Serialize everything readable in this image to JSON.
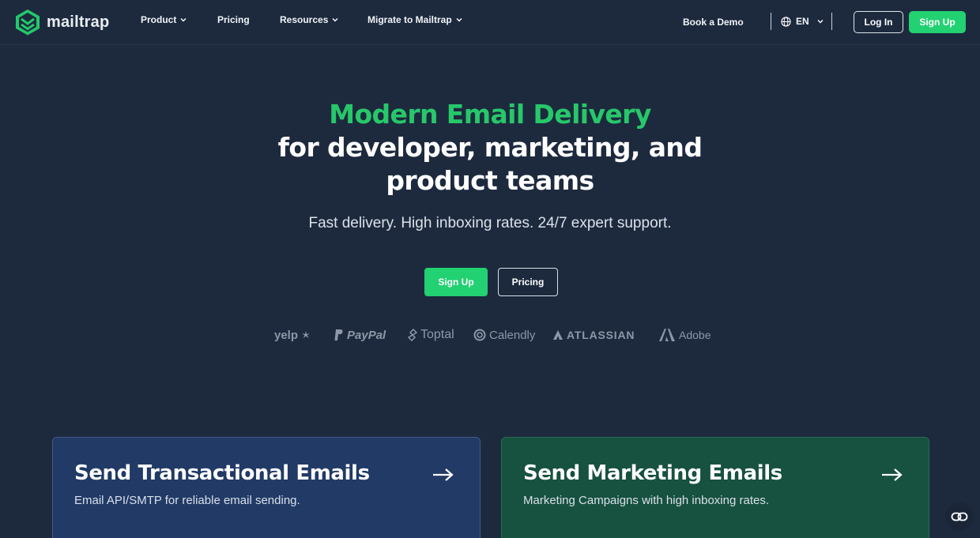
{
  "brand": {
    "name": "mailtrap"
  },
  "nav": {
    "items": [
      {
        "label": "Product",
        "has_dropdown": true
      },
      {
        "label": "Pricing",
        "has_dropdown": false
      },
      {
        "label": "Resources",
        "has_dropdown": true
      },
      {
        "label": "Migrate to Mailtrap",
        "has_dropdown": true
      }
    ],
    "book_demo": "Book a Demo",
    "language": "EN",
    "login": "Log In",
    "signup": "Sign Up"
  },
  "hero": {
    "title_line1": "Modern Email Delivery",
    "title_line2": "for developer, marketing, and",
    "title_line3": "product teams",
    "subtitle": "Fast delivery. High inboxing rates. 24/7 expert support.",
    "cta_primary": "Sign Up",
    "cta_secondary": "Pricing"
  },
  "customer_logos": [
    "yelp",
    "PayPal",
    "Toptal",
    "Calendly",
    "ATLASSIAN",
    "Adobe"
  ],
  "cards": [
    {
      "title": "Send Transactional Emails",
      "description": "Email API/SMTP for reliable email sending.",
      "color": "#213a66"
    },
    {
      "title": "Send Marketing Emails",
      "description": "Marketing Campaigns with high inboxing rates.",
      "color": "#17513f"
    }
  ],
  "colors": {
    "background": "#1d2a3e",
    "accent": "#22d172",
    "headline_green": "#27c76a"
  },
  "icons": {
    "logo": "mailtrap-logo-icon",
    "language": "globe-icon",
    "arrow": "arrow-right-icon",
    "chat": "chat-icon"
  }
}
